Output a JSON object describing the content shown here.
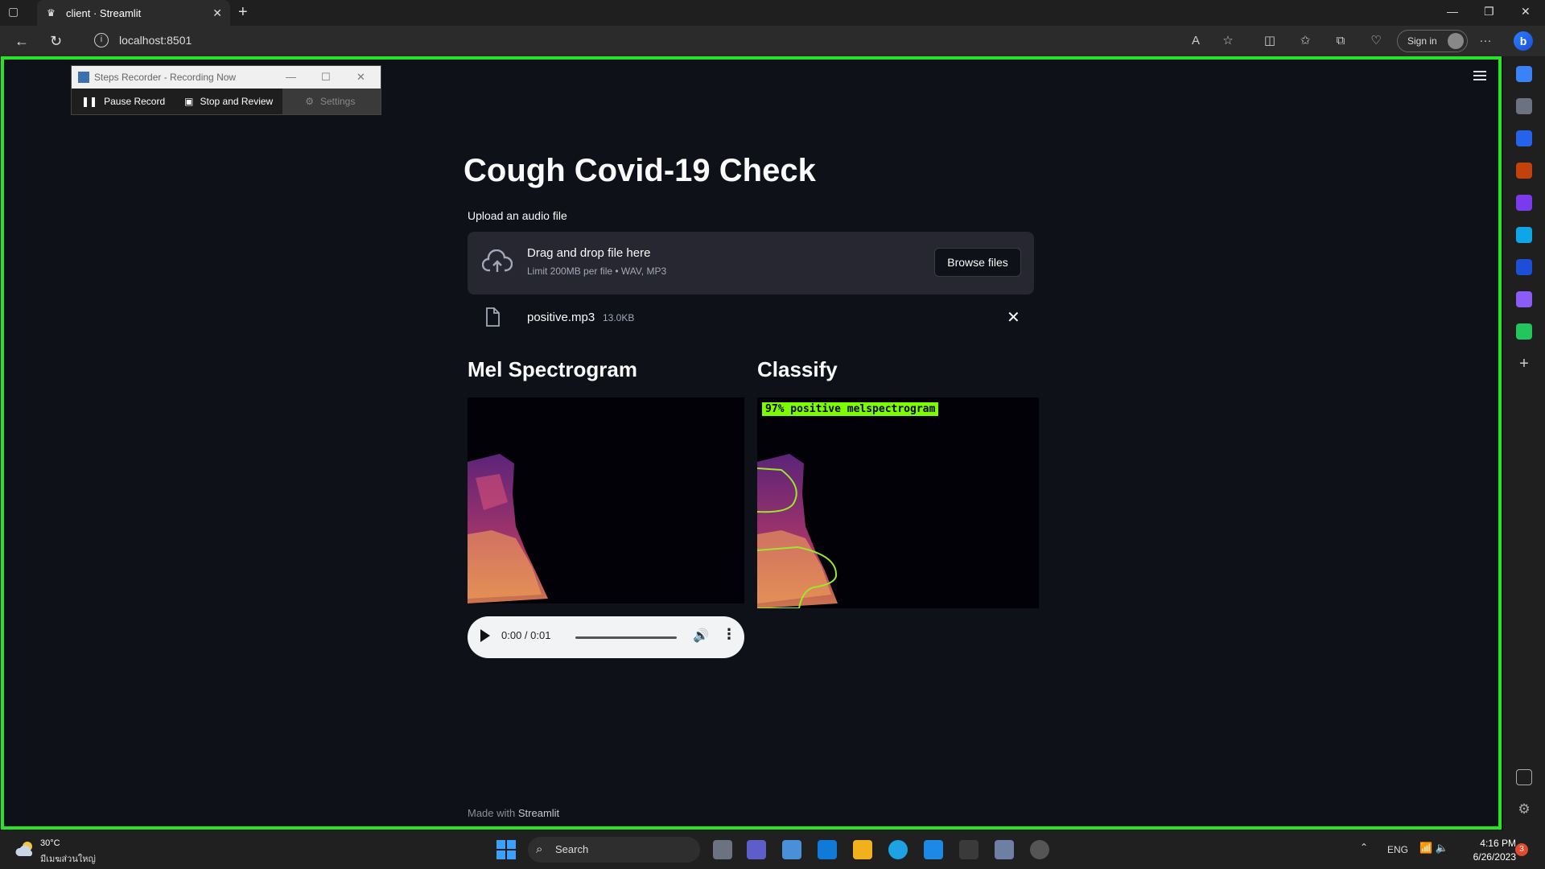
{
  "browser": {
    "tab_title": "client · Streamlit",
    "url": "localhost:8501",
    "sign_in": "Sign in"
  },
  "steps_recorder": {
    "title": "Steps Recorder - Recording Now",
    "pause": "Pause Record",
    "stop": "Stop and Review",
    "settings": "Settings"
  },
  "app": {
    "title": "Cough Covid-19 Check",
    "upload_label": "Upload an audio file",
    "drop_main": "Drag and drop file here",
    "drop_sub": "Limit 200MB per file • WAV, MP3",
    "browse": "Browse files",
    "file_name": "positive.mp3",
    "file_size": "13.0KB",
    "mel_heading": "Mel Spectrogram",
    "classify_heading": "Classify",
    "classify_label": "97% positive  melspectrogram",
    "audio_time": "0:00 / 0:01",
    "footer_prefix": "Made with ",
    "footer_brand": "Streamlit"
  },
  "taskbar": {
    "weather_temp": "30°C",
    "weather_desc": "มีเมฆส่วนใหญ่",
    "search": "Search",
    "lang": "ENG",
    "time": "4:16 PM",
    "date": "6/26/2023",
    "notifications": "3"
  }
}
